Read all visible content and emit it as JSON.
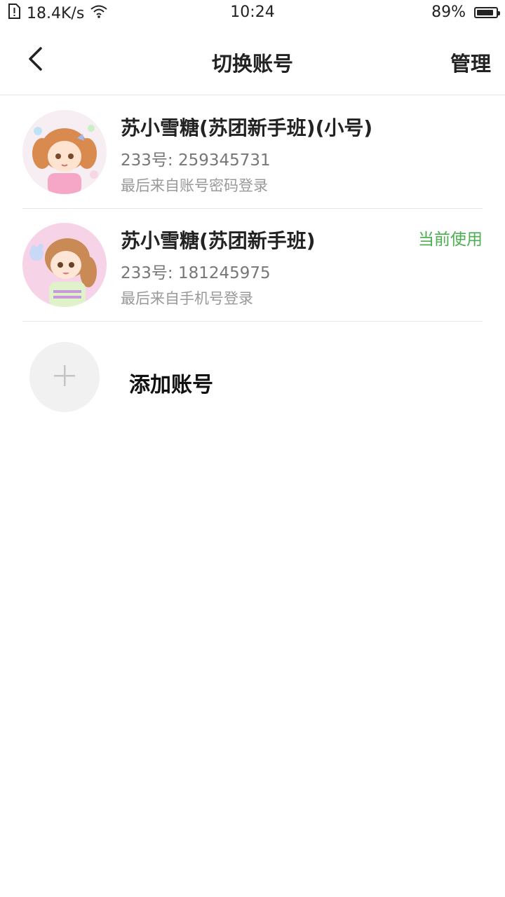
{
  "status_bar": {
    "network_speed": "18.4K/s",
    "time": "10:24",
    "battery_percent": "89%",
    "battery_level": 0.89,
    "icons": [
      "sim-alert-icon",
      "wifi-icon",
      "battery-icon"
    ]
  },
  "header": {
    "title": "切换账号",
    "manage_label": "管理",
    "back_icon": "chevron-left-icon"
  },
  "accounts": [
    {
      "name": "苏小雪糖(苏团新手班)(小号)",
      "id_text": "233号: 259345731",
      "login_text": "最后来自账号密码登录",
      "current_label": ""
    },
    {
      "name": "苏小雪糖(苏团新手班)",
      "id_text": "233号: 181245975",
      "login_text": "最后来自手机号登录",
      "current_label": "当前使用"
    }
  ],
  "add_account": {
    "label": "添加账号",
    "icon": "plus-icon"
  },
  "colors": {
    "accent_green": "#4caf50",
    "divider": "#e8e8e8",
    "add_circle_bg": "#f1f1f1"
  }
}
